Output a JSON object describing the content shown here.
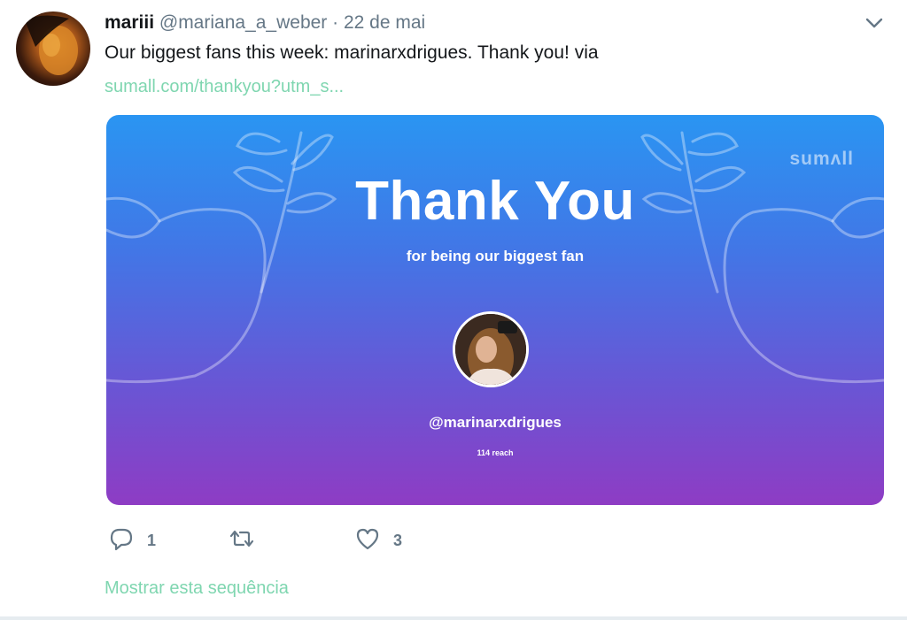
{
  "tweet": {
    "author_name": "mariii",
    "author_handle": "@mariana_a_weber",
    "separator": "·",
    "date": "22 de mai",
    "text": "Our biggest fans this week: marinarxdrigues. Thank you! via",
    "link": "sumall.com/thankyou?utm_s..."
  },
  "card": {
    "logo": "sumʌll",
    "title": "Thank You",
    "subtitle": "for being our biggest fan",
    "fan_handle": "@marinarxdrigues",
    "fan_reach": "114 reach",
    "gradient_top": "#2a95f2",
    "gradient_bottom": "#8e3cc4"
  },
  "actions": {
    "reply_count": "1",
    "retweet_count": "",
    "like_count": "3"
  },
  "footer": {
    "show_thread": "Mostrar esta sequência"
  },
  "colors": {
    "link": "#7fd6b0",
    "muted": "#657786",
    "text": "#14171a"
  },
  "icons": {
    "reply": "reply-icon",
    "retweet": "retweet-icon",
    "like": "heart-icon",
    "menu": "chevron-down-icon"
  }
}
